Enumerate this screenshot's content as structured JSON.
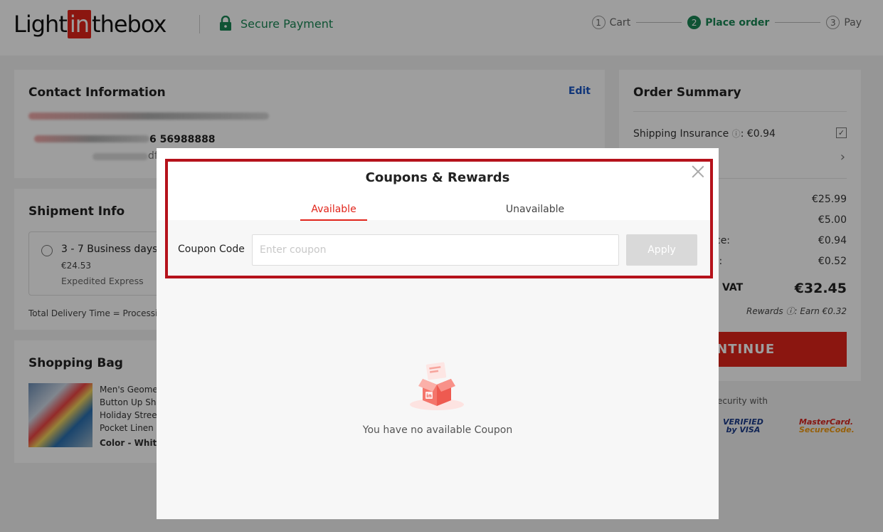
{
  "header": {
    "logo": {
      "light": "Light",
      "in": "in",
      "thebox": "thebox"
    },
    "secure_payment": "Secure Payment",
    "steps": [
      {
        "num": "1",
        "label": "Cart"
      },
      {
        "num": "2",
        "label": "Place order"
      },
      {
        "num": "3",
        "label": "Pay"
      }
    ]
  },
  "contact": {
    "title": "Contact Information",
    "edit": "Edit",
    "phone_partial": "6 56988888",
    "partial_text": "df"
  },
  "shipment": {
    "title": "Shipment Info",
    "option_title": "3 - 7 Business days",
    "option_price": "€24.53",
    "option_method": "Expedited Express",
    "delivery_time": "Total Delivery Time = Processi"
  },
  "bag": {
    "title": "Shopping Bag",
    "product_name": "Men's Geome\nButton Up Sh\nHoliday Stree\nPocket Linen",
    "product_color": "Color - Whit"
  },
  "summary": {
    "title": "Order Summary",
    "insurance_label": "Shipping Insurance",
    "insurance_value": "€0.94",
    "amounts": [
      "€25.99",
      "€5.00",
      "€0.94",
      "€0.52"
    ],
    "partial_labels": [
      "ce:",
      "):"
    ],
    "total_label_partial": "l. VAT",
    "total_value": "€32.45",
    "rewards": "Rewards ⓘ: Earn €0.32",
    "continue_partial": "ONTINUE",
    "security_partial": "ecurity with",
    "visa_line1": "VERIFIED",
    "visa_line2": "by VISA",
    "mc_line1": "MasterCard.",
    "mc_line2": "SecureCode."
  },
  "modal": {
    "title": "Coupons & Rewards",
    "tabs": [
      "Available",
      "Unavailable"
    ],
    "coupon_label": "Coupon Code",
    "coupon_placeholder": "Enter coupon",
    "coupon_value": "",
    "apply": "Apply",
    "empty_text": "You have no available Coupon"
  },
  "colors": {
    "brand_red": "#e1251b",
    "secure_green": "#198754",
    "highlight_border": "#b5121b"
  }
}
